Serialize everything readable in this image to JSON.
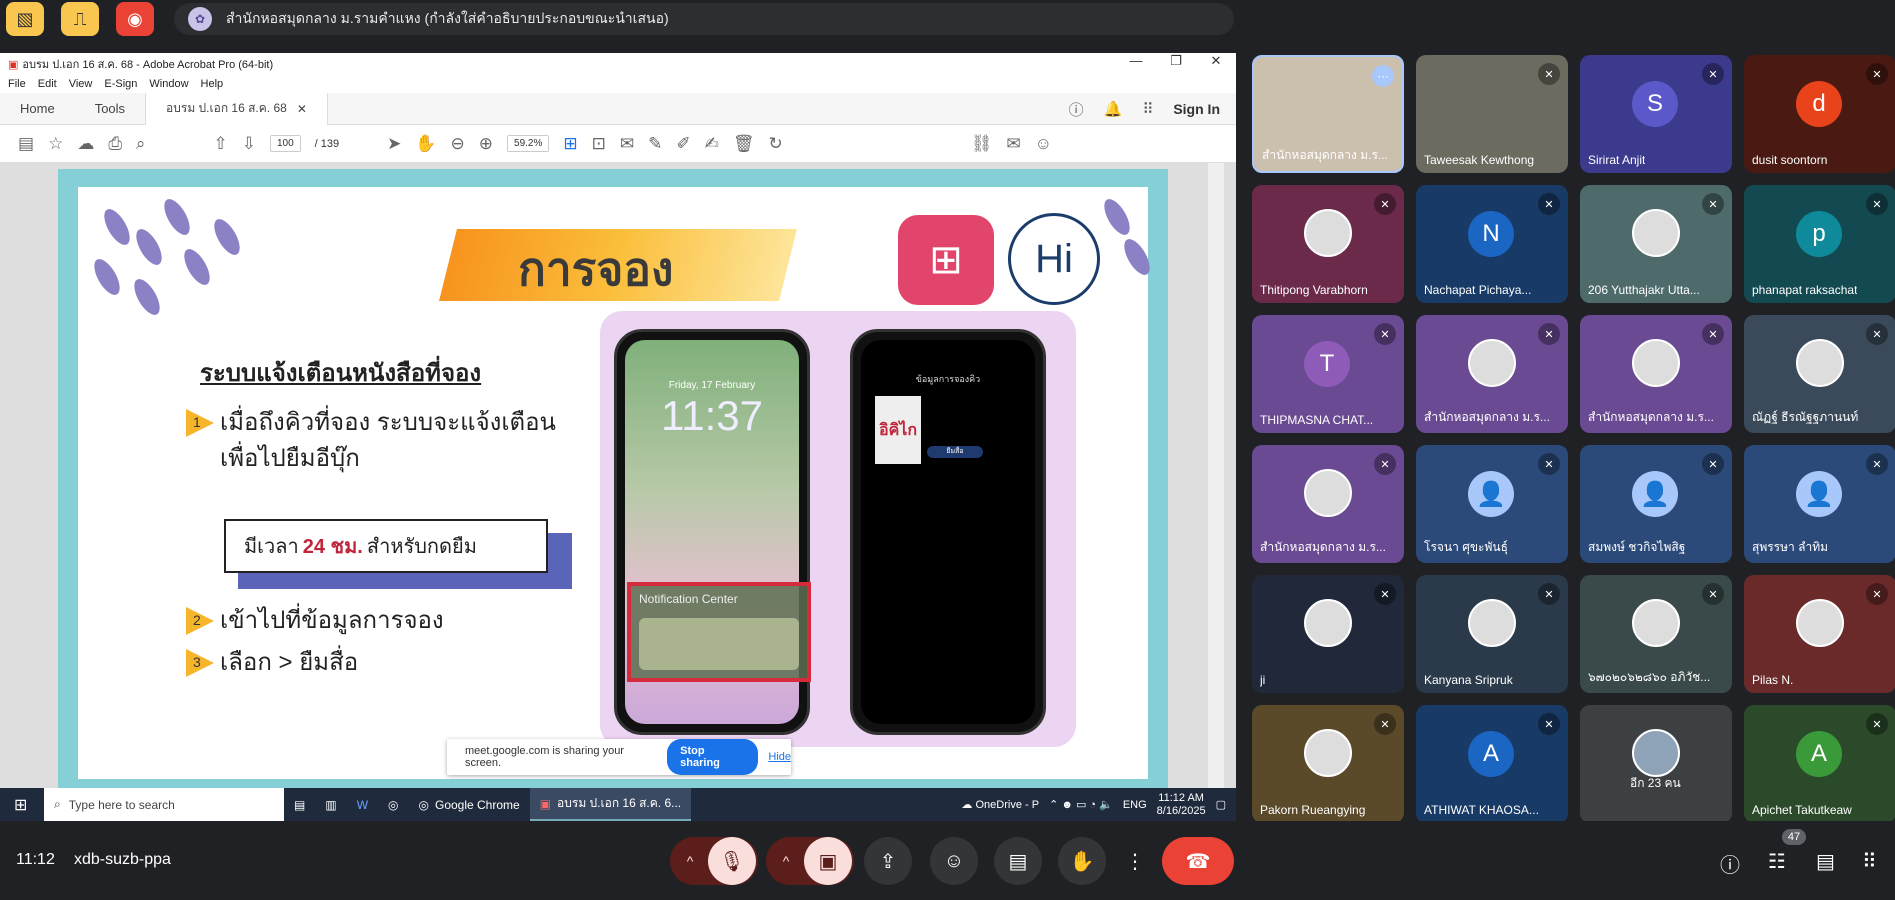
{
  "top_bar": {
    "presenter_text": "สำนักหอสมุดกลาง ม.รามคำแหง (กำลังใส่คำอธิบายประกอบขณะนำเสนอ)"
  },
  "acrobat": {
    "window_title": "อบรม ป.เอก 16 ส.ค. 68 - Adobe Acrobat Pro (64-bit)",
    "menu": [
      "File",
      "Edit",
      "View",
      "E-Sign",
      "Window",
      "Help"
    ],
    "tabs": {
      "home": "Home",
      "tools": "Tools",
      "doc": "อบรม ป.เอก 16 ส.ค. 68"
    },
    "sign_in": "Sign In",
    "page_current": "100",
    "page_total": "/ 139",
    "zoom": "59.2%"
  },
  "slide": {
    "title": "การจอง",
    "heading": "ระบบแจ้งเตือนหนังสือที่จอง",
    "items": [
      {
        "num": "1",
        "line1": "เมื่อถึงคิวที่จอง ระบบจะแจ้งเตือน",
        "line2": "เพื่อไปยืมอีบุ๊ก"
      },
      {
        "num": "2",
        "line1": "เข้าไปที่ข้อมูลการจอง"
      },
      {
        "num": "3",
        "line1": "เลือก > ยืมสื่อ"
      }
    ],
    "notice": {
      "before": "มีเวลา",
      "bold": "24 ชม.",
      "after": "สำหรับกดยืม"
    },
    "phone1": {
      "date": "Friday, 17 February",
      "clock": "11:37",
      "notif_header": "Notification Center"
    },
    "phone2": {
      "header": "ข้อมูลการจองคิว",
      "button": "ยืมสื่อ"
    }
  },
  "share_bar": {
    "message": "meet.google.com is sharing your screen.",
    "stop": "Stop sharing",
    "hide": "Hide"
  },
  "taskbar": {
    "search_placeholder": "Type here to search",
    "apps": [
      "Google Chrome",
      "อบรม ป.เอก 16 ส.ค. 6..."
    ],
    "onedrive": "OneDrive - P",
    "lang": "ENG",
    "time": "11:12 AM",
    "date": "8/16/2025"
  },
  "participants": [
    {
      "name": "สำนักหอสมุดกลาง ม.ร...",
      "type": "photo",
      "color": "#cbbfae"
    },
    {
      "name": "Taweesak Kewthong",
      "type": "photo",
      "color": "#6b6b60"
    },
    {
      "name": "Sirirat Anjit",
      "type": "avatar",
      "letter": "S",
      "color": "#5b58c9",
      "bg": "#3c3a8c"
    },
    {
      "name": "dusit soontorn",
      "type": "avatar",
      "letter": "d",
      "color": "#e8431b",
      "bg": "#4a1a12"
    },
    {
      "name": "Thitipong Varabhorn",
      "type": "photo",
      "color": "#6b2a4a"
    },
    {
      "name": "Nachapat Pichaya...",
      "type": "avatar",
      "letter": "N",
      "color": "#1a66c2",
      "bg": "#173a66"
    },
    {
      "name": "206 Yutthajakr Utta...",
      "type": "photo",
      "color": "#4e6a6a"
    },
    {
      "name": "phanapat raksachat",
      "type": "avatar",
      "letter": "p",
      "color": "#0f8a9a",
      "bg": "#134a52"
    },
    {
      "name": "THIPMASNA CHAT...",
      "type": "avatar",
      "letter": "T",
      "color": "#8e5cb8",
      "bg": "#6a4a92"
    },
    {
      "name": "สำนักหอสมุดกลาง ม.ร...",
      "type": "photo",
      "color": "#6a4a92"
    },
    {
      "name": "สำนักหอสมุดกลาง ม.ร...",
      "type": "photo",
      "color": "#6a4a92"
    },
    {
      "name": "ณัฏฐ์ ธีรณัฐฐภานนท์",
      "type": "photo",
      "color": "#3a4a5a"
    },
    {
      "name": "สำนักหอสมุดกลาง ม.ร...",
      "type": "photo",
      "color": "#6a4a92"
    },
    {
      "name": "โรจนา ศุขะพันธุ์",
      "type": "avatar",
      "letter": "",
      "color": "#a8c7fa",
      "bg": "#2b4a7a"
    },
    {
      "name": "สมพงษ์ ชวกิจไพสิฐ",
      "type": "avatar",
      "letter": "",
      "color": "#a8c7fa",
      "bg": "#2b4a7a"
    },
    {
      "name": "สุพรรษา ลำทิม",
      "type": "avatar",
      "letter": "",
      "color": "#a8c7fa",
      "bg": "#2b4a7a"
    },
    {
      "name": "ji",
      "type": "photo",
      "color": "#20283a"
    },
    {
      "name": "Kanyana Sripruk",
      "type": "photo",
      "color": "#2a3a4a"
    },
    {
      "name": "๖๗๐๒๐๖๒๘๖๐ อภิวัช...",
      "type": "photo",
      "color": "#3a4a4a"
    },
    {
      "name": "Pilas N.",
      "type": "photo",
      "color": "#6a2a2a"
    },
    {
      "name": "Pakorn Rueangying",
      "type": "photo",
      "color": "#5a4a2a"
    },
    {
      "name": "ATHIWAT KHAOSA...",
      "type": "avatar",
      "letter": "A",
      "color": "#1a66c2",
      "bg": "#173a66"
    },
    {
      "name": "อีก 23 คน",
      "type": "others",
      "color": "#3c4043"
    },
    {
      "name": "Apichet Takutkeaw",
      "type": "avatar",
      "letter": "A",
      "color": "#3a9a3a",
      "bg": "#2a4a2a"
    }
  ],
  "bottom": {
    "clock": "11:12",
    "meeting_code": "xdb-suzb-ppa",
    "participants_count": "47"
  },
  "colors": {
    "end_call": "#ea4335",
    "muted_bg": "#f9dedc",
    "accent_blue": "#1a73e8"
  }
}
